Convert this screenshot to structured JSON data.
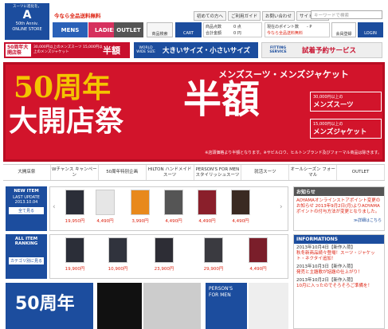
{
  "header": {
    "logo": {
      "tag": "スーツに進化を。",
      "mark": "A",
      "line1": "50th Anniv.",
      "line2": "ONLINE STORE"
    },
    "free_shipping": "今なら全品送料無料",
    "top_links": [
      "初めての方へ",
      "ご利用ガイド",
      "お問い合わせ",
      "サイトマップ"
    ],
    "search_placeholder": "キーワードで検索",
    "tabs": [
      "MENS",
      "LADIES",
      "OUTLET"
    ],
    "buttons": {
      "search": "商品検索",
      "cart": "CART",
      "member": "会員登録",
      "login": "LOGIN"
    },
    "cart_info": {
      "line1": "商品点数　　　0 点",
      "line2": "合計金額　　　0 円"
    },
    "point_info": {
      "line1": "現在のポイント数　　- P",
      "line2": "今なら全品送料無料"
    }
  },
  "promo": {
    "p1": {
      "a": "50周年大開店祭",
      "b": "30,000円以上のメンズスーツ 15,000円以上のメンズジャケット",
      "c": "半額"
    },
    "p2": {
      "a": "WORLD WIDE SIZE",
      "b": "大きいサイズ・小さいサイズ"
    },
    "p3": {
      "a": "FITTING SERVICE",
      "b": "試着予約サービス"
    }
  },
  "hero": {
    "line1": "50周年",
    "line2": "大開店祭",
    "sub": "メンズスーツ・メンズジャケット",
    "big": "半額",
    "box1": {
      "s": "30,000円以上の",
      "m": "メンズスーツ"
    },
    "box2": {
      "s": "15,000円以上の",
      "m": "メンズジャケット"
    },
    "note": "※店頭価格より半額となります。※サビルロウ、ヒルトンブランド及びフォーマル商品は除きます。"
  },
  "categories": [
    "大開店祭",
    "Wチャンス キャンペーン",
    "50周年特別企画",
    "HILTON ハンドメイドスーツ",
    "PERSON'S FOR MEN スタイリッシュスーツ",
    "就活スーツ",
    "オールシーズン フォーマル",
    "OUTLET"
  ],
  "new_item": {
    "title": "NEW ITEM",
    "update": "LAST UPDATE 2013.10.04",
    "btn": "全て見る"
  },
  "ranking": {
    "title": "ALL ITEM RANKING",
    "btn": "カテゴリ別に見る"
  },
  "new_prices": [
    "19,950円",
    "4,490円",
    "3,990円",
    "4,490円",
    "4,490円",
    "4,490円"
  ],
  "rank_prices": [
    "19,900円",
    "10,900円",
    "23,900円",
    "29,900円",
    "4,490円"
  ],
  "news": {
    "title": "お知らせ",
    "body": "AOYAMAオンラインストアポイント変更のお知らせ 2013年9月2日(月)よりAOYAMAポイントの付与方法が変更となりました。",
    "more": "≫詳細はこちら"
  },
  "info": {
    "title": "INFORMATIONS",
    "items": [
      {
        "d": "2013年10月4日【新作入荷】",
        "t": "秋冬新商品続々登場！スーツ・ジャケット・ネクタイ追加！"
      },
      {
        "d": "2013年10月3日【新作入荷】",
        "t": "発売と主題歌が話題の仕上がり！"
      },
      {
        "d": "2013年10月2日【新作入荷】",
        "t": "10月に入ったのでそろそろご準備を！"
      }
    ]
  },
  "banners": {
    "b1": "50周年",
    "b4": "PERSON'S FOR MEN"
  },
  "colors": {
    "brand": "#1c4d9e",
    "accent": "#d2142b",
    "gold": "#f4c400"
  }
}
